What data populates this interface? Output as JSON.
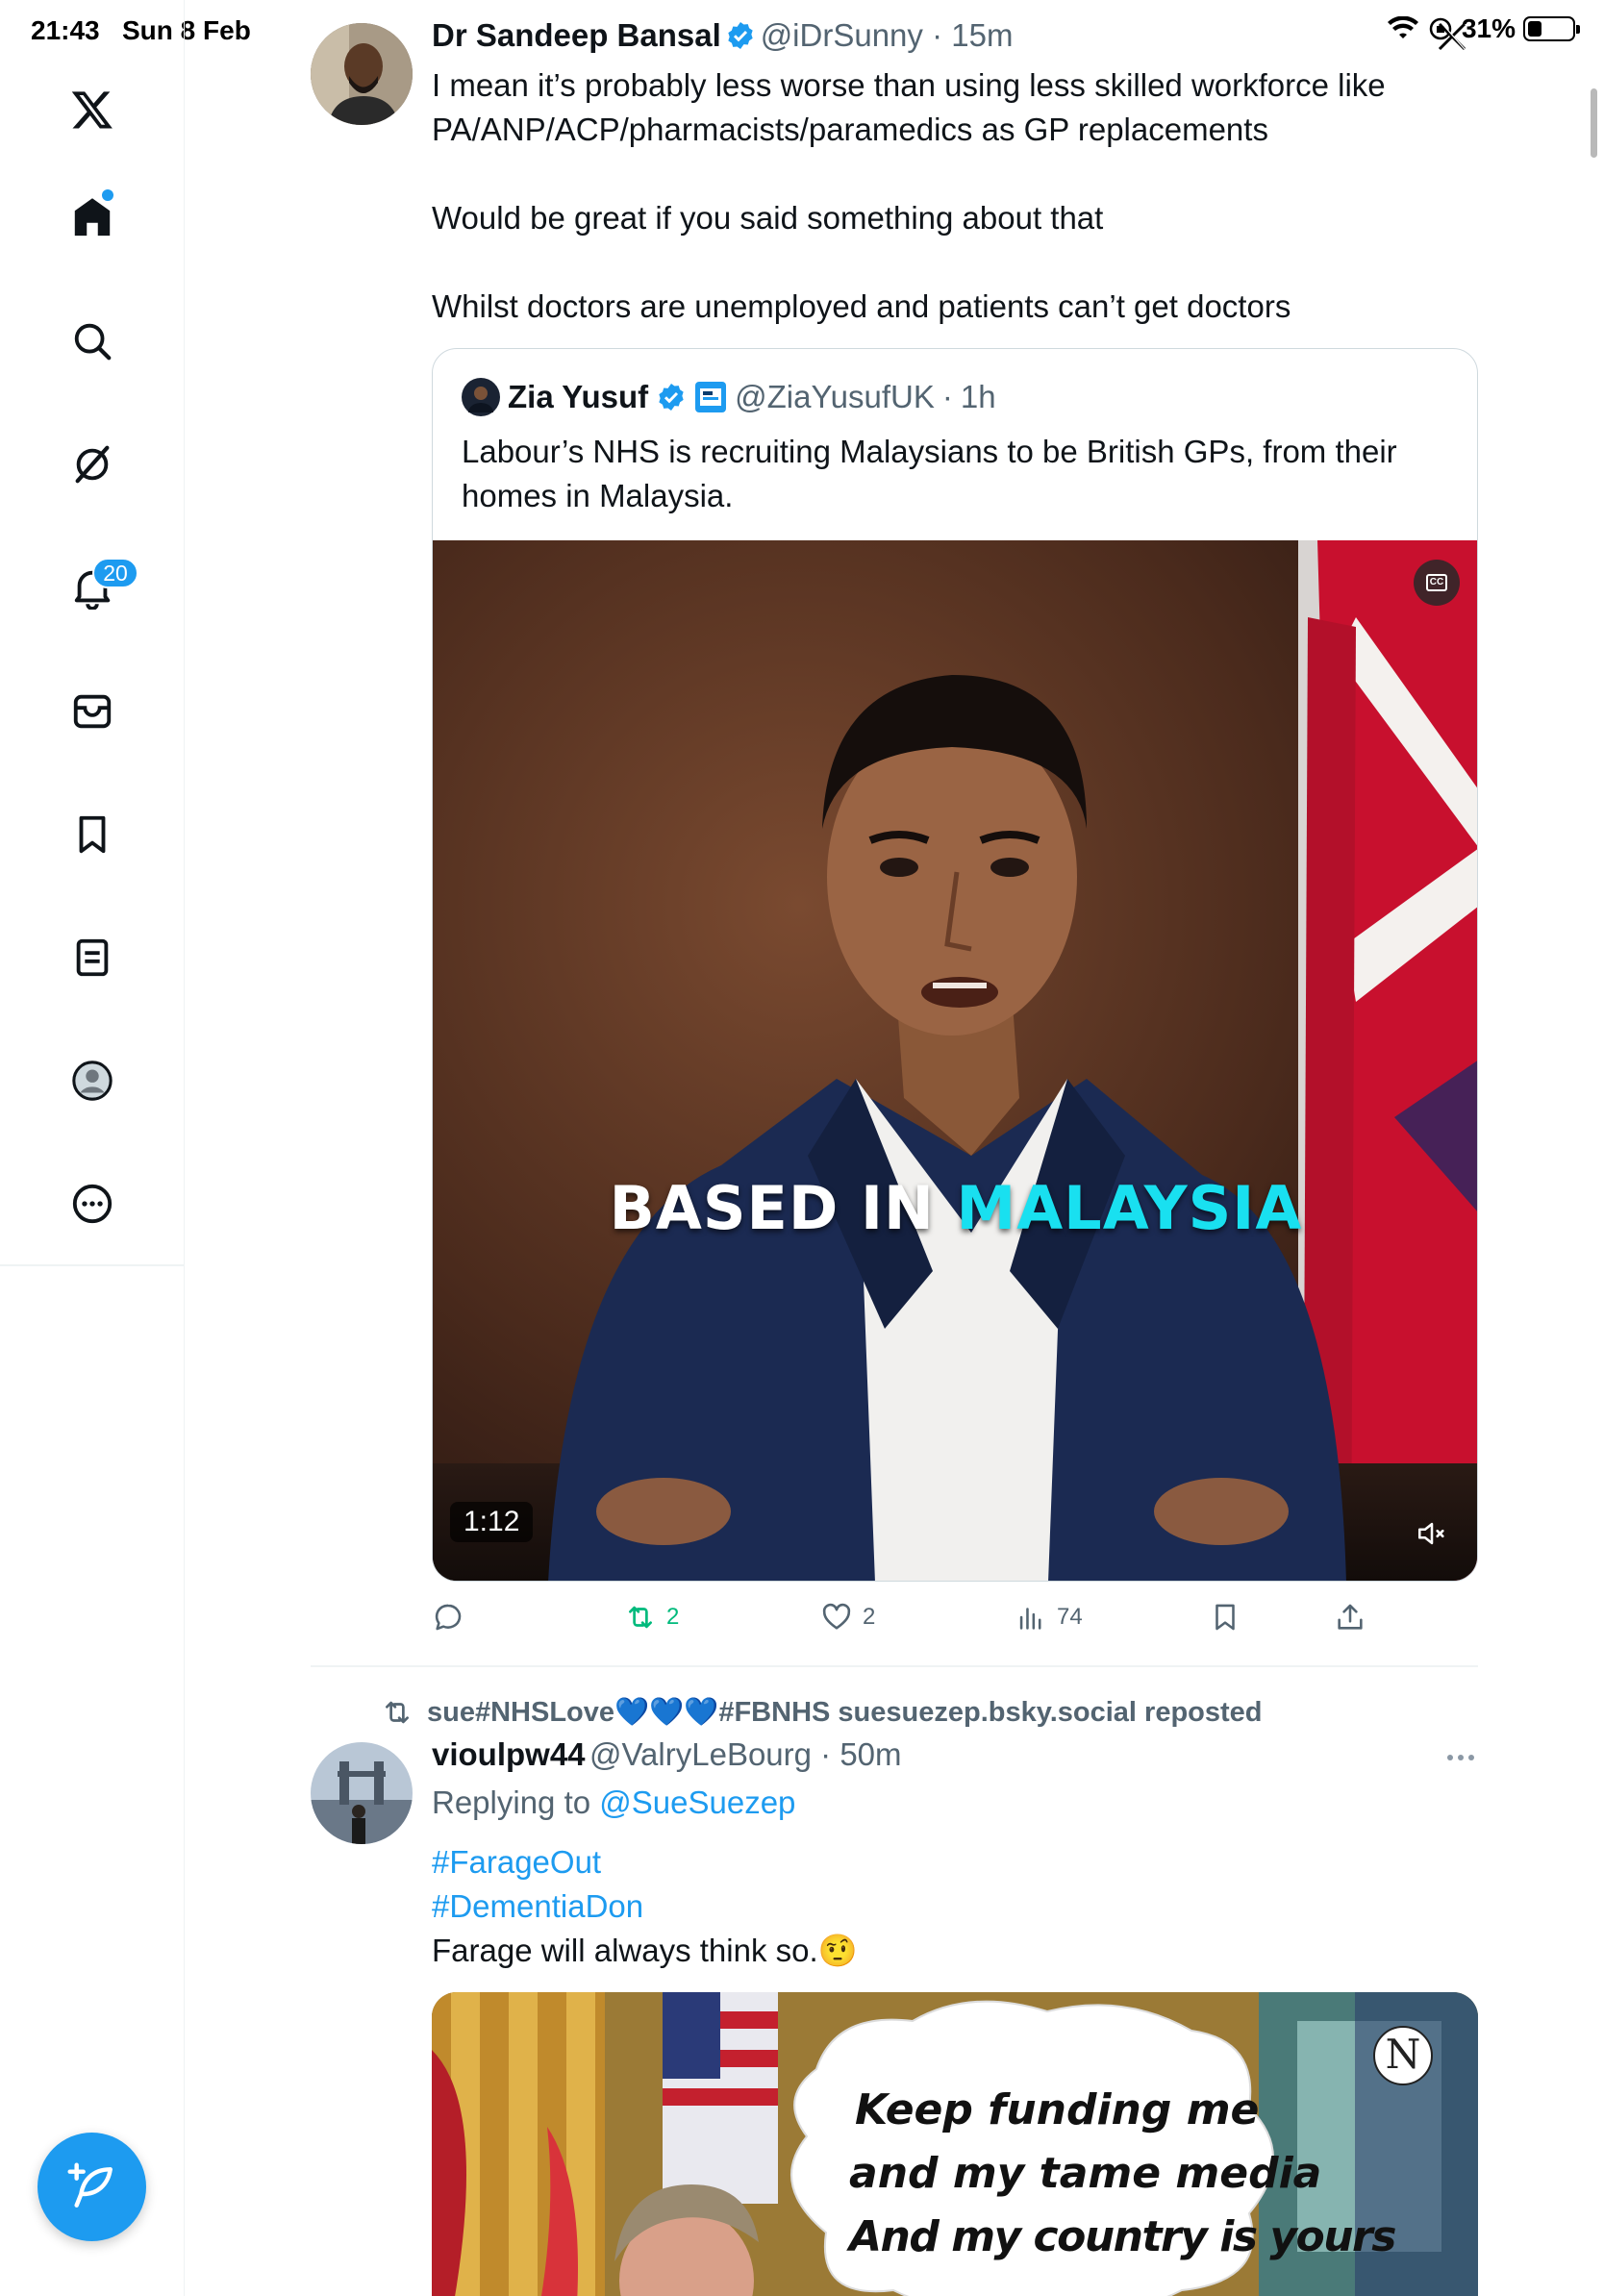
{
  "status_bar": {
    "time": "21:43",
    "date": "Sun 8 Feb",
    "battery": "31%",
    "battery_level": 0.31
  },
  "sidebar": {
    "notifications_count": "20",
    "items": [
      "x-logo-icon",
      "home-icon",
      "search-icon",
      "grok-icon",
      "notifications-icon",
      "messages-icon",
      "bookmarks-icon",
      "lists-icon",
      "profile-icon",
      "more-icon"
    ]
  },
  "tweet1": {
    "name": "Dr Sandeep Bansal",
    "handle": "@iDrSunny",
    "time": "15m",
    "text": "I mean it’s probably less worse than using less skilled workforce like PA/ANP/ACP/pharmacists/paramedics as GP replacements\n\nWould be great if you said something about that\n\nWhilst doctors are unemployed and patients can’t get doctors",
    "quote": {
      "name": "Zia Yusuf",
      "handle": "@ZiaYusufUK",
      "time": "1h",
      "text": "Labour’s NHS is recruiting Malaysians to be British GPs, from their homes in Malaysia.",
      "caption_white": "BASED IN ",
      "caption_cyan": "MALAYSIA",
      "duration": "1:12",
      "cc_label": "CC"
    },
    "actions": {
      "reposts": "2",
      "likes": "2",
      "views": "74"
    }
  },
  "tweet2": {
    "repost_line": "sue#NHSLove💙💙💙#FBNHS suesuezep.bsky.social reposted",
    "name": "vioulpw44",
    "handle": "@ValryLeBourg",
    "time": "50m",
    "replying_prefix": "Replying to ",
    "replying_handle": "@SueSuezep",
    "hashtag1": "#FarageOut",
    "hashtag2": "#DementiaDon",
    "text": "Farage will always think so.🤨",
    "image_text_1": "Keep funding me",
    "image_text_2": "and my tame media",
    "image_text_3": "And my country is yours",
    "image_logo": "N"
  },
  "colors": {
    "accent": "#1d9bf0",
    "repost_green": "#00ba7c",
    "secondary_text": "#536471",
    "caption_cyan": "#19e0f0"
  }
}
